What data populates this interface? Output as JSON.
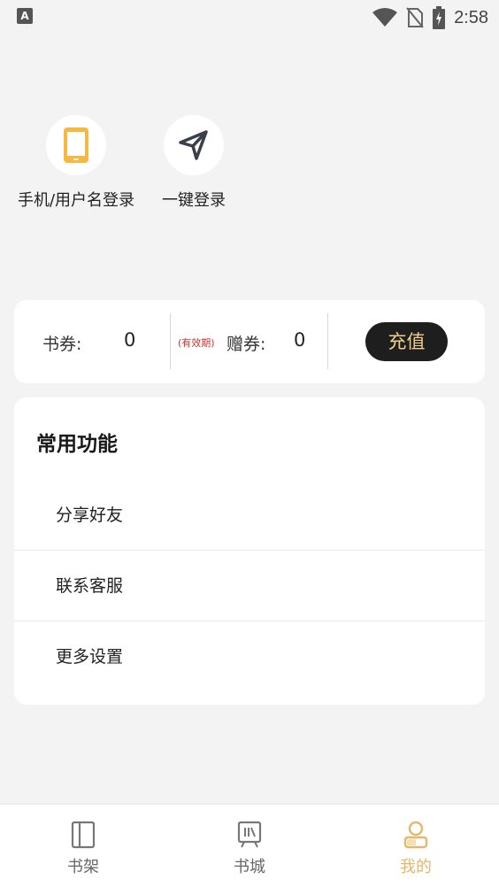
{
  "status_bar": {
    "left_icon_letter": "A",
    "time": "2:58",
    "icons": [
      "wifi-icon",
      "no-sim-icon",
      "battery-charging-icon"
    ]
  },
  "login_options": [
    {
      "label": "手机/用户名登录",
      "icon": "phone-icon",
      "icon_color": "#f5b942"
    },
    {
      "label": "一键登录",
      "icon": "send-arrow-icon",
      "icon_color": "#3a3f4c"
    }
  ],
  "coupons": {
    "book_coupon_label": "书券:",
    "book_coupon_value": "0",
    "validity_note": "(有效期)",
    "gift_coupon_label": "赠券:",
    "gift_coupon_value": "0",
    "recharge_label": "充值"
  },
  "functions": {
    "title": "常用功能",
    "items": [
      {
        "label": "分享好友"
      },
      {
        "label": "联系客服"
      },
      {
        "label": "更多设置"
      }
    ]
  },
  "bottom_nav": {
    "items": [
      {
        "label": "书架",
        "icon": "bookshelf-icon",
        "active": false
      },
      {
        "label": "书城",
        "icon": "bookstore-icon",
        "active": false
      },
      {
        "label": "我的",
        "icon": "profile-icon",
        "active": true
      }
    ],
    "active_color": "#e3b86a",
    "inactive_color": "#666666"
  },
  "colors": {
    "background": "#f3f3f3",
    "card": "#ffffff",
    "accent_gold": "#f0cf8c",
    "validity_red": "#d0302a",
    "dark_button": "#1e1e1e"
  }
}
